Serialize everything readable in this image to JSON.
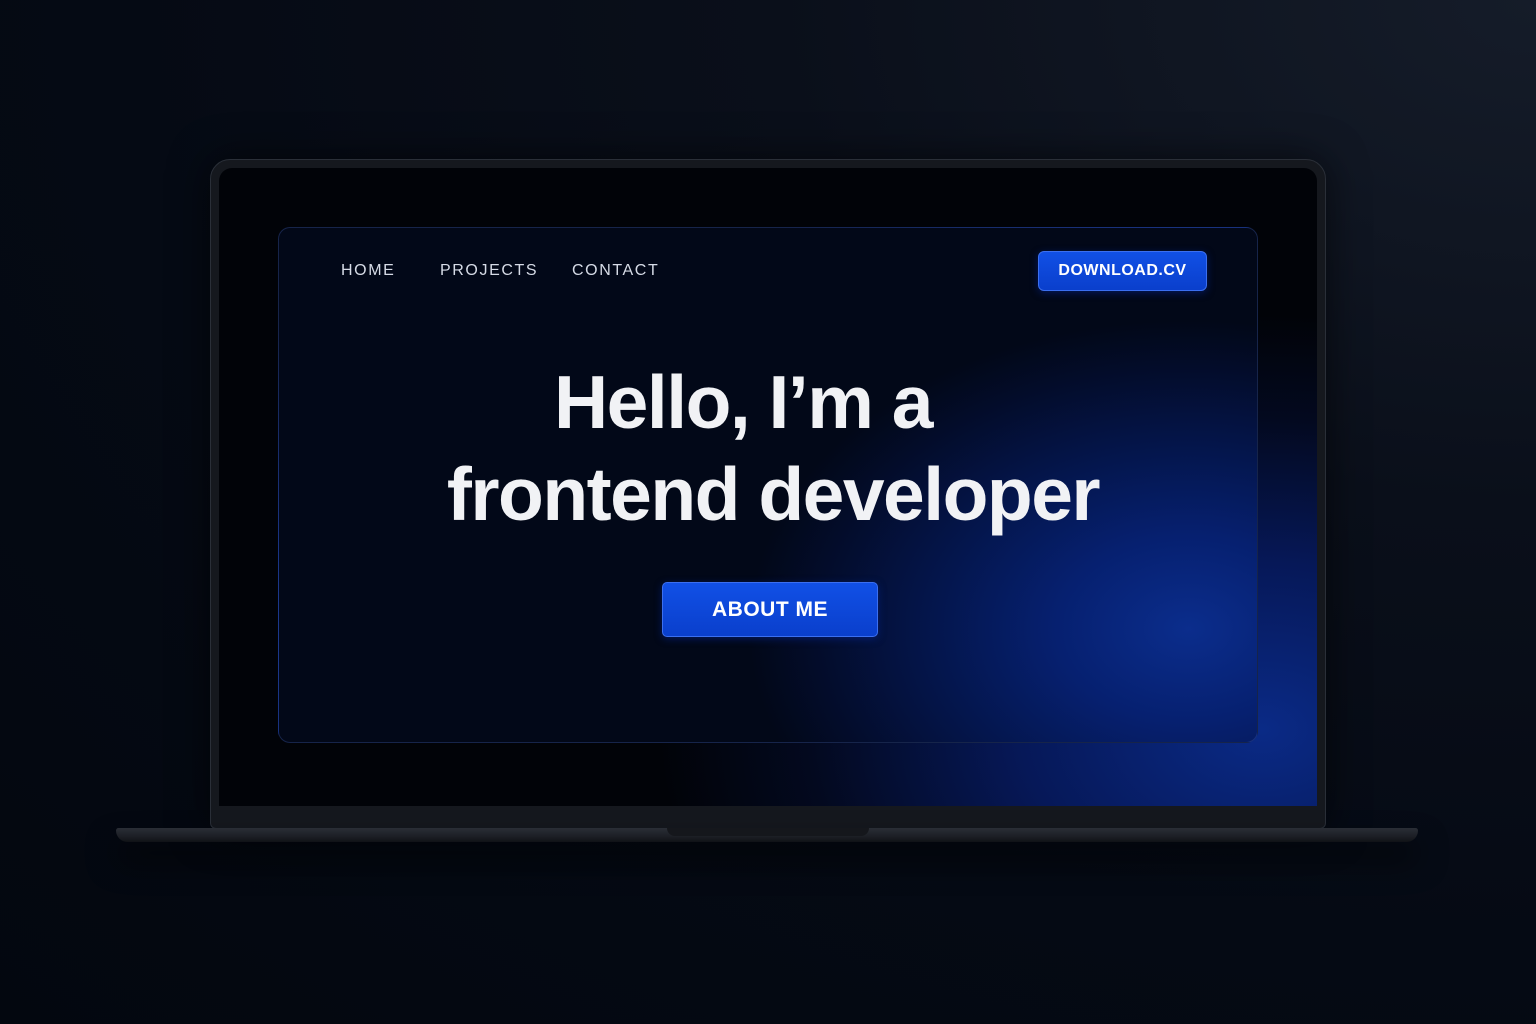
{
  "nav": {
    "home": "HOME",
    "projects": "PROJECTS",
    "contact": "CONTACT"
  },
  "header_button": "DOWNLOAD.CV",
  "hero": {
    "line1": "Hello, I’m a",
    "line2": "frontend developer",
    "cta": "ABOUT ME"
  },
  "colors": {
    "accent": "#0a44d6",
    "background": "#050a14",
    "text": "#f1f2f5"
  }
}
